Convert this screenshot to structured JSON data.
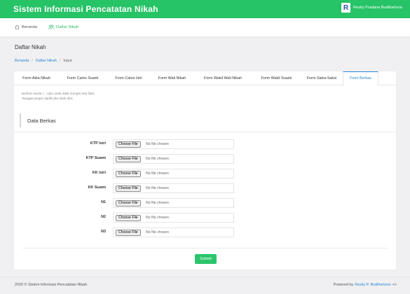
{
  "header": {
    "title": "Sistem Informasi Pencatatan Nikah",
    "avatar_letter": "R",
    "user_name": "Rezky Pradana Budihartono",
    "accent": "#27c367"
  },
  "nav": {
    "home_label": "Beranda",
    "home_icon": "home-icon",
    "list_label": "Daftar Nikah",
    "list_icon": "users-icon"
  },
  "page": {
    "title": "Daftar Nikah",
    "breadcrumb": [
      "Beranda",
      "Daftar Nikah",
      "Input"
    ],
    "breadcrumb_sep": "/"
  },
  "tabs": [
    "Form Akta Nikah",
    "Form Calon Suami",
    "Form Calon Istri",
    "Form Wali Nikah",
    "Form Wakil Wali Nikah",
    "Form Wakil Suami",
    "Form Saksi-Saksi",
    "Form Berkas"
  ],
  "active_tab": "Form Berkas",
  "note": {
    "line1": "Berikan tanda ( - ) jika anda tidak mengisi text field.",
    "line2": "Tanggal jangan dipilih jika tidak diisi."
  },
  "section": {
    "title": "Data Berkas"
  },
  "fields": [
    {
      "label": "KTP Istri",
      "button": "Choose File",
      "status": "No file chosen"
    },
    {
      "label": "KTP Suami",
      "button": "Choose File",
      "status": "No file chosen"
    },
    {
      "label": "KK Istri",
      "button": "Choose File",
      "status": "No file chosen"
    },
    {
      "label": "KK Suami",
      "button": "Choose File",
      "status": "No file chosen"
    },
    {
      "label": "N1",
      "button": "Choose File",
      "status": "No file chosen"
    },
    {
      "label": "N2",
      "button": "Choose File",
      "status": "No file chosen"
    },
    {
      "label": "N3",
      "button": "Choose File",
      "status": "No file chosen"
    }
  ],
  "submit_label": "Submit",
  "footer": {
    "left": "2020 © Sistem Informasi Pencatatan Nikah.",
    "right_prefix": "Powered by",
    "right_link": "Rezky P. Budihartono",
    "right_icon": "code-icon",
    "right_code": "<>"
  }
}
